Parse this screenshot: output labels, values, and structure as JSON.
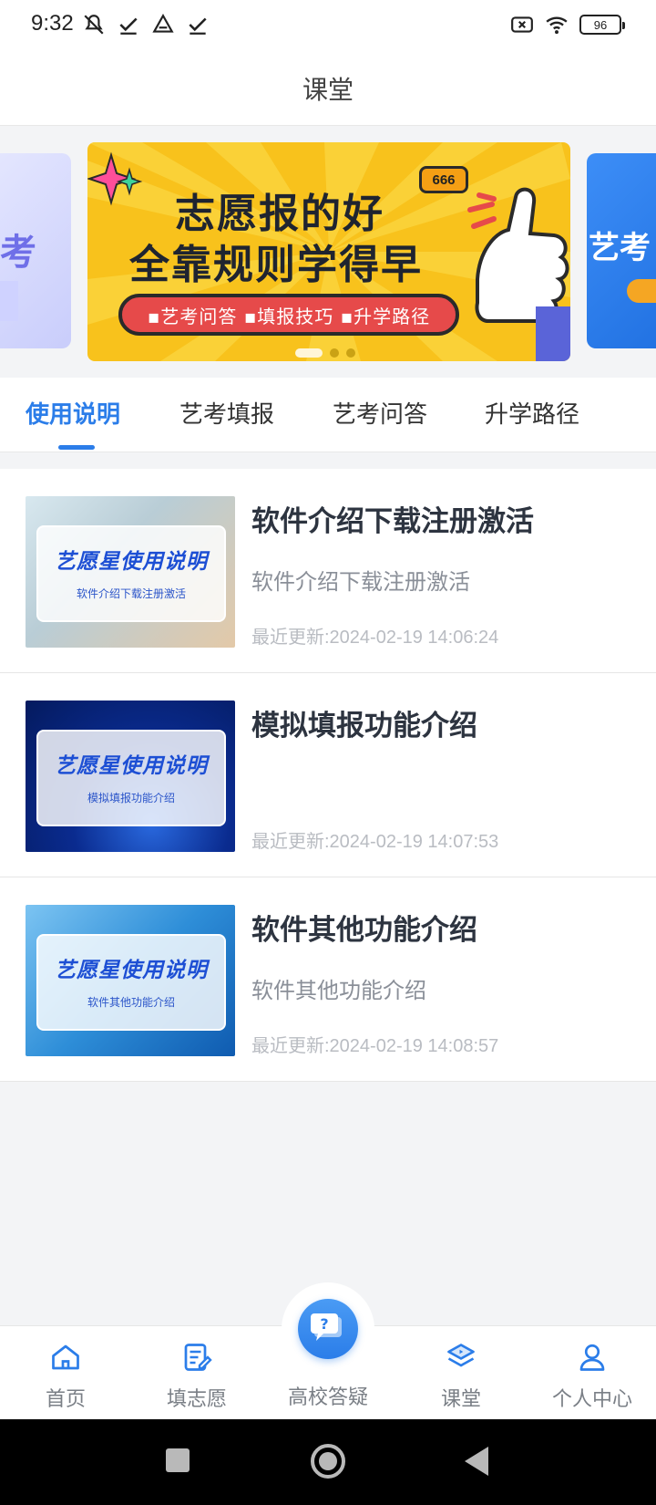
{
  "status_bar": {
    "time": "9:32",
    "battery": "96",
    "left_icons": [
      "mute-icon",
      "check-icon",
      "drive-icon",
      "check-icon"
    ],
    "right_icons": [
      "no-sim-icon",
      "wifi-icon",
      "battery-icon"
    ]
  },
  "header": {
    "title": "课堂"
  },
  "banner": {
    "line1": "志愿报的好",
    "line2": "全靠规则学得早",
    "pill": "▪艺考问答 ▪填报技巧 ▪升学路径",
    "badge": "666",
    "left_peek": "考",
    "right_peek": "艺考",
    "active_dot": 0,
    "dot_count": 3
  },
  "tabs": [
    {
      "label": "使用说明",
      "active": true
    },
    {
      "label": "艺考填报",
      "active": false
    },
    {
      "label": "艺考问答",
      "active": false
    },
    {
      "label": "升学路径",
      "active": false
    }
  ],
  "articles": [
    {
      "title": "软件介绍下载注册激活",
      "description": "软件介绍下载注册激活",
      "updated": "最近更新:2024-02-19 14:06:24",
      "thumb_title": "艺愿星使用说明",
      "thumb_sub": "软件介绍下载注册激活"
    },
    {
      "title": "模拟填报功能介绍",
      "description": "",
      "updated": "最近更新:2024-02-19 14:07:53",
      "thumb_title": "艺愿星使用说明",
      "thumb_sub": "模拟填报功能介绍"
    },
    {
      "title": "软件其他功能介绍",
      "description": "软件其他功能介绍",
      "updated": "最近更新:2024-02-19 14:08:57",
      "thumb_title": "艺愿星使用说明",
      "thumb_sub": "软件其他功能介绍"
    }
  ],
  "bottom_nav": [
    {
      "label": "首页",
      "icon": "home-icon",
      "active": false
    },
    {
      "label": "填志愿",
      "icon": "edit-form-icon",
      "active": false
    },
    {
      "label": "高校答疑",
      "icon": "question-chat-icon",
      "active": false
    },
    {
      "label": "课堂",
      "icon": "classroom-icon",
      "active": true
    },
    {
      "label": "个人中心",
      "icon": "user-icon",
      "active": false
    }
  ],
  "colors": {
    "accent": "#2b7de9",
    "banner_bg": "#f8c21c",
    "pill": "#e64a4a"
  }
}
